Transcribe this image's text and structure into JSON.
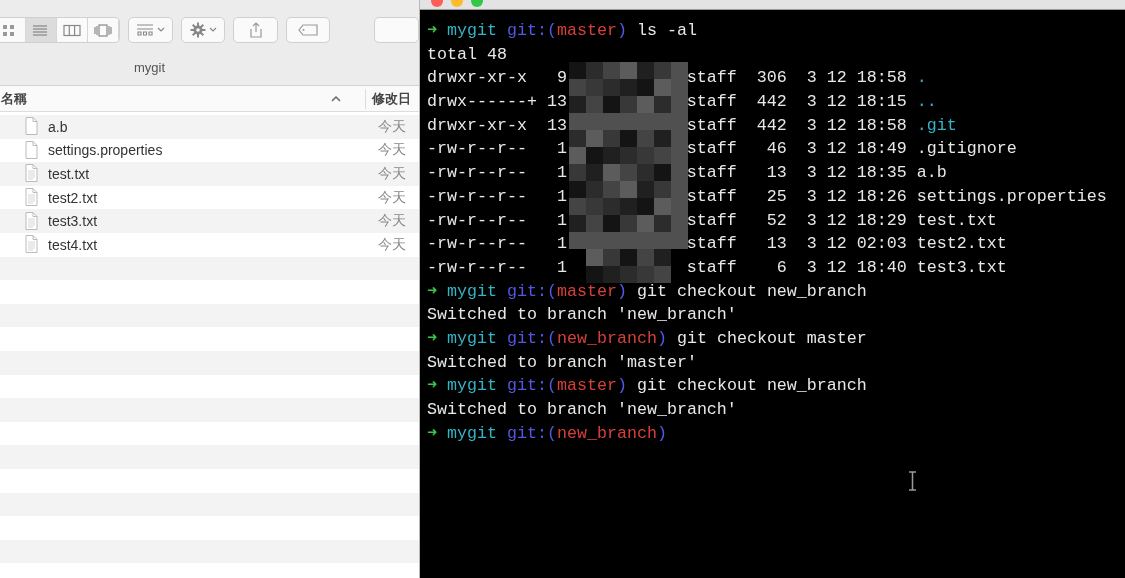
{
  "finder": {
    "view_modes": [
      {
        "kind": "icons",
        "selected": false
      },
      {
        "kind": "list",
        "selected": true
      },
      {
        "kind": "columns",
        "selected": false
      },
      {
        "kind": "coverflow",
        "selected": false
      }
    ],
    "path": "mygit",
    "columns": [
      {
        "label": "名稱",
        "sorted": true
      },
      {
        "label": "修改日",
        "sorted": false
      }
    ],
    "files": [
      {
        "name": "a.b",
        "date": "今天",
        "kind": "blank"
      },
      {
        "name": "settings.properties",
        "date": "今天",
        "kind": "blank"
      },
      {
        "name": "test.txt",
        "date": "今天",
        "kind": "text"
      },
      {
        "name": "test2.txt",
        "date": "今天",
        "kind": "text"
      },
      {
        "name": "test3.txt",
        "date": "今天",
        "kind": "text"
      },
      {
        "name": "test4.txt",
        "date": "今天",
        "kind": "text"
      }
    ]
  },
  "terminal": {
    "lines": [
      {
        "kind": "prompt",
        "arrow": "➜",
        "dir": "mygit",
        "git_open": "git:(",
        "branch": "master",
        "git_close": ")",
        "command": "ls -al"
      },
      {
        "kind": "output",
        "text": "total 48"
      },
      {
        "kind": "entry",
        "perms": "drwxr-xr-x",
        "links": "9",
        "group": "staff",
        "size": "306",
        "month": "3",
        "day": "12",
        "time": "18:58",
        "name": ".",
        "directory": true
      },
      {
        "kind": "entry",
        "perms": "drwx------+",
        "links": "13",
        "group": "staff",
        "size": "442",
        "month": "3",
        "day": "12",
        "time": "18:15",
        "name": "..",
        "directory": true
      },
      {
        "kind": "entry",
        "perms": "drwxr-xr-x",
        "links": "13",
        "group": "staff",
        "size": "442",
        "month": "3",
        "day": "12",
        "time": "18:58",
        "name": ".git",
        "directory": true
      },
      {
        "kind": "entry",
        "perms": "-rw-r--r--",
        "links": "1",
        "group": "staff",
        "size": "46",
        "month": "3",
        "day": "12",
        "time": "18:49",
        "name": ".gitignore",
        "directory": false
      },
      {
        "kind": "entry",
        "perms": "-rw-r--r--",
        "links": "1",
        "group": "staff",
        "size": "13",
        "month": "3",
        "day": "12",
        "time": "18:35",
        "name": "a.b",
        "directory": false
      },
      {
        "kind": "entry",
        "perms": "-rw-r--r--",
        "links": "1",
        "group": "staff",
        "size": "25",
        "month": "3",
        "day": "12",
        "time": "18:26",
        "name": "settings.properties",
        "directory": false
      },
      {
        "kind": "entry",
        "perms": "-rw-r--r--",
        "links": "1",
        "group": "staff",
        "size": "52",
        "month": "3",
        "day": "12",
        "time": "18:29",
        "name": "test.txt",
        "directory": false
      },
      {
        "kind": "entry",
        "perms": "-rw-r--r--",
        "links": "1",
        "group": "staff",
        "size": "13",
        "month": "3",
        "day": "12",
        "time": "02:03",
        "name": "test2.txt",
        "directory": false
      },
      {
        "kind": "entry",
        "perms": "-rw-r--r--",
        "links": "1",
        "group": "staff",
        "size": "6",
        "month": "3",
        "day": "12",
        "time": "18:40",
        "name": "test3.txt",
        "directory": false
      },
      {
        "kind": "prompt",
        "arrow": "➜",
        "dir": "mygit",
        "git_open": "git:(",
        "branch": "master",
        "git_close": ")",
        "command": "git checkout new_branch"
      },
      {
        "kind": "output",
        "text": "Switched to branch 'new_branch'"
      },
      {
        "kind": "prompt",
        "arrow": "➜",
        "dir": "mygit",
        "git_open": "git:(",
        "branch": "new_branch",
        "git_close": ")",
        "command": "git checkout master"
      },
      {
        "kind": "output",
        "text": "Switched to branch 'master'"
      },
      {
        "kind": "prompt",
        "arrow": "➜",
        "dir": "mygit",
        "git_open": "git:(",
        "branch": "master",
        "git_close": ")",
        "command": "git checkout new_branch"
      },
      {
        "kind": "output",
        "text": "Switched to branch 'new_branch'"
      },
      {
        "kind": "prompt",
        "arrow": "➜",
        "dir": "mygit",
        "git_open": "git:(",
        "branch": "new_branch",
        "git_close": ")"
      }
    ]
  }
}
